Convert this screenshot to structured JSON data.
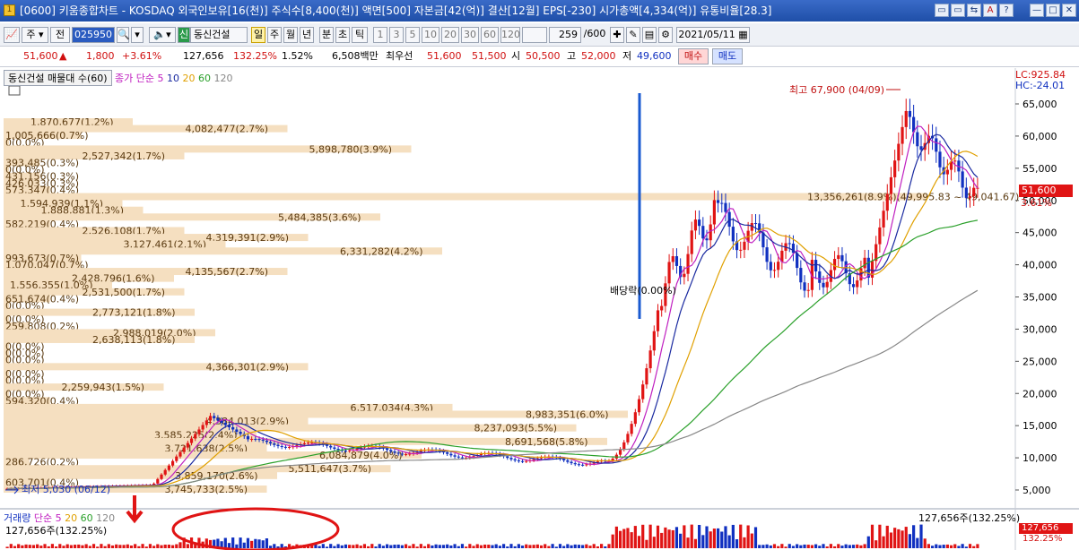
{
  "window": {
    "title": "[0600] 키움종합차트 - KOSDAQ 외국인보유[16(천)] 주식수[8,400(천)] 액면[500] 자본금[42(억)] 결산[12월] EPS[-230] 시가총액[4,334(억)] 유통비율[28.3]",
    "app_icon": "1",
    "buttons": [
      "▭",
      "▭",
      "⇆",
      "A",
      "?",
      "—",
      "□",
      "✕"
    ]
  },
  "toolbar": {
    "type_label": "주",
    "prev_label": "전",
    "code": "025950",
    "stock_name": "동신건설",
    "period_tabs": [
      "일",
      "주",
      "월",
      "년",
      "분",
      "초",
      "틱"
    ],
    "interval_buttons": [
      "1",
      "3",
      "5",
      "10",
      "20",
      "30",
      "60",
      "120"
    ],
    "count": "259",
    "count_total": "/600",
    "date": "2021/05/11"
  },
  "quote": {
    "price": "51,600",
    "change_arrow": "▲",
    "change": "1,800",
    "change_pct": "+3.61%",
    "volume": "127,656",
    "vol_ratio": "132.25%",
    "turnover": "1.52%",
    "amount": "6,508백만",
    "priority_label": "최우선",
    "ask": "51,600",
    "bid": "51,500",
    "open_label": "시",
    "open": "50,500",
    "high_label": "고",
    "high": "52,000",
    "low_label": "저",
    "low": "49,600",
    "buy_label": "매수",
    "sell_label": "매도"
  },
  "price_panel": {
    "legend_title": "동신건설 매물대 수(60)",
    "ma_label": "종가 단순",
    "ma_periods": [
      "5",
      "10",
      "20",
      "60",
      "120"
    ],
    "lc": "LC:925.84",
    "hc": "HC:-24.01",
    "current_price": "51,600",
    "current_pct": "3.61%",
    "high_annotation": "최고 67,900 (04/09)",
    "low_annotation": "최저 5,030 (06/12)",
    "dividend_annotation": "배당락(0.00%)",
    "y_ticks": [
      "65,000",
      "60,000",
      "55,000",
      "50,000",
      "45,000",
      "40,000",
      "35,000",
      "30,000",
      "25,000",
      "20,000",
      "15,000",
      "10,000",
      "5,000"
    ],
    "volume_profile": [
      "1,870,677(1.2%)",
      "4,082,477(2.7%)",
      "1,005,666(0.7%)",
      "0(0.0%)",
      "5,898,780(3.9%)",
      "2,527,342(1.7%)",
      "393,485(0.3%)",
      "0(0.0%)",
      "431,156(0.3%)",
      "426,033(0.3%)",
      "573,347(0.4%)",
      "13,356,261(8.9%)(49,995.83 ~ 49,041.67)",
      "1,594,939(1.1%)",
      "1,888,881(1.3%)",
      "5,484,385(3.6%)",
      "582,219(0.4%)",
      "2,526,108(1.7%)",
      "4,319,391(2.9%)",
      "3,127,461(2.1%)",
      "6,331,282(4.2%)",
      "993,673(0.7%)",
      "1,070,047(0.7%)",
      "4,135,567(2.7%)",
      "2,428,796(1.6%)",
      "1,556,355(1.0%)",
      "2,531,500(1.7%)",
      "651,674(0.4%)",
      "0(0.0%)",
      "2,773,121(1.8%)",
      "0(0.0%)",
      "259,808(0.2%)",
      "2,988,019(2.0%)",
      "2,638,113(1.8%)",
      "0(0.0%)",
      "0(0.0%)",
      "0(0.0%)",
      "4,366,301(2.9%)",
      "0(0.0%)",
      "0(0.0%)",
      "2,259,943(1.5%)",
      "0(0.0%)",
      "594,320(0.4%)",
      "6,517,034(4.3%)",
      "8,983,351(6.0%)",
      "4,384,013(2.9%)",
      "8,237,093(5.5%)",
      "3,585,225(2.4%)",
      "8,691,568(5.8%)",
      "3,721,638(2.5%)",
      "6,084,879(4.0%)",
      "286,726(0.2%)",
      "5,511,647(3.7%)",
      "3,859,170(2.6%)",
      "603,701(0.4%)",
      "3,745,733(2.5%)"
    ]
  },
  "volume_panel": {
    "legend_title": "거래량",
    "ma_label": "단순",
    "ma_periods": [
      "5",
      "20",
      "60",
      "120"
    ],
    "sub_value": "127,656주(132.25%)",
    "right_value": "127,656주(132.25%)",
    "tag_value": "127,656",
    "tag_pct": "132.25%"
  },
  "colors": {
    "up": "#e01414",
    "down": "#1030c0",
    "ma5": "#c020c0",
    "ma10": "#1a2aa0",
    "ma20": "#e0a000",
    "ma60": "#2aa02a",
    "ma120": "#888888",
    "profile": "#f5dfc0",
    "annotation_circle": "#e01414"
  }
}
